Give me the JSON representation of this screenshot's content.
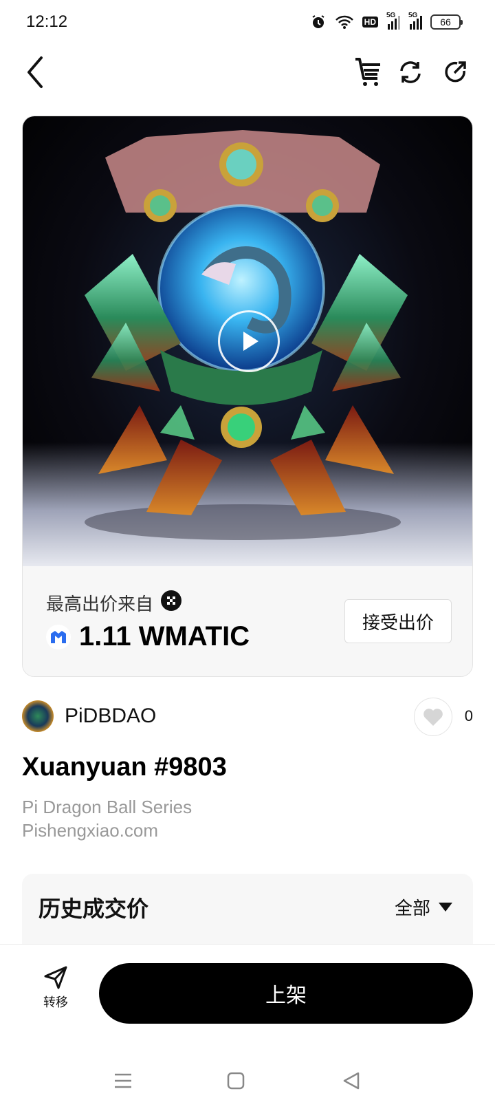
{
  "status_bar": {
    "time": "12:12",
    "network_1": "5G",
    "network_2": "5G",
    "hd_badge": "HD",
    "battery": "66"
  },
  "nav": {
    "back_icon": "chevron-left-icon",
    "cart_icon": "cart-icon",
    "refresh_icon": "refresh-icon",
    "share_icon": "share-icon"
  },
  "bid": {
    "label": "最高出价来自",
    "value": "1.11 WMATIC",
    "accept_label": "接受出价"
  },
  "creator": {
    "name": "PiDBDAO",
    "likes": "0"
  },
  "item": {
    "title": "Xuanyuan #9803",
    "series": "Pi Dragon Ball Series",
    "website": "Pishengxiao.com"
  },
  "history": {
    "title": "历史成交价",
    "filter_label": "全部"
  },
  "actions": {
    "transfer_label": "转移",
    "list_label": "上架"
  },
  "colors": {
    "primary": "#000000",
    "muted_text": "#999999",
    "panel_bg": "#f7f7f7",
    "matic_blue": "#2b6def"
  }
}
